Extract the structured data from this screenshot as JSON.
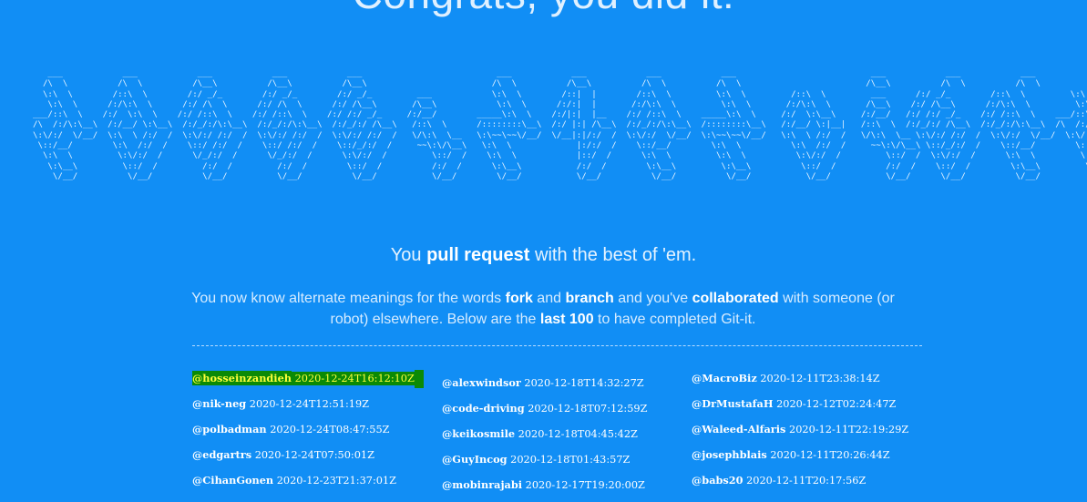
{
  "hero": {
    "title": "Congrats, you did it!"
  },
  "ascii_banner": "   ___            ___            ___            ___            ___                           ___            ___            ___            ___                           ___            ___            ___            ___\n  /\\  \\          /\\  \\          /\\__\\          /\\__\\          /\\__\\                         /\\  \\          /\\__\\          /\\  \\          /\\  \\                         /\\__\\          /\\  \\          /\\  \\\n  \\:\\  \\        /::\\  \\        /:/ _/_        /:/ _/_        /:/ _/_         ___            \\:\\  \\        /::|  |        /::\\  \\         \\:\\  \\         /::\\  \\         ___      /:/ _/_        /::\\  \\         \\:\\  \\\n   \\:\\  \\      /:/\\:\\  \\      /:/ /\\  \\      /:/ /\\  \\      /:/ /\\__\\       /\\__\\            \\:\\  \\      /:/:|  |       /:/\\:\\  \\         \\:\\  \\       /:/\\:\\  \\       /\\__\\    /:/ /\\__\\      /:/\\:\\  \\         \\:\\  \\\n___/::\\  \\    /:/  \\:\\  \\    /:/ /::\\  \\    /:/ /::\\  \\    /:/ /:/ _/_     /:/__/        _____\\:\\  \\    /:/|:|  |__    /:/ /::\\  \\    _____\\:\\  \\     /:/  \\:\\__\\     /:/__/   /:/ /:/ _/_    /:/ /::\\  \\    ___/::\\  \\\n/\\  /:/\\:\\__\\  /:/__/ \\:\\__\\  /:/_/:/\\:\\__\\  /:/_/:/\\:\\__\\  /:/_/:/ /\\__\\   /::\\  \\      /::::::::\\__\\  /:/ |:| /\\__\\  /:/_/:/\\:\\__\\  /::::::::\\__\\   /:/__/ \\:|__|   /::\\  \\  /:/_/:/ /\\__\\  /:/_/:/\\:\\__\\  /\\  /:/\\:\\__\\\n\\:\\/:/  \\/__/  \\:\\  \\ /:/  /  \\:\\/:/ /:/  /  \\:\\/:/ /:/  /  \\:\\/:/ /:/  /   \\/\\:\\  \\__   \\:\\~~\\~~\\/__/  \\/__|:|/:/  /  \\:\\/:/  \\/__/  \\:\\~~\\~~\\/__/   \\:\\  \\ /:/  /   \\/\\:\\  \\__ \\:\\/:/ /:/  /  \\:\\/:/  \\/__/  \\:\\/:/  \\/__/\n \\::/__/        \\:\\  /:/  /    \\::/ /:/  /    \\::/ /:/  /    \\::/_/:/  /     ~~\\:\\/\\__\\   \\:\\  \\             |:/:/  /    \\::/__/        \\:\\  \\          \\:\\  /:/  /     ~~\\:\\/\\__\\ \\::/_/:/  /    \\::/__/        \\::/__/\n  \\:\\  \\         \\:\\/:/  /      \\/_/:/  /      \\/_/:/  /      \\:\\/:/  /         \\::/  /    \\:\\  \\            |::/  /      \\:\\  \\         \\:\\  \\          \\:\\/:/  /         \\::/  /  \\:\\/:/  /      \\:\\  \\         \\:\\  \\\n   \\:\\__\\         \\::/  /         /:/  /         /:/  /        \\::/  /          /:/  /      \\:\\__\\           /:/  /        \\:\\__\\         \\:\\__\\          \\::/  /          /:/  /    \\::/  /        \\:\\__\\         \\:\\__\\\n    \\/__/          \\/__/          \\/__/          \\/__/          \\/__/           \\/__/        \\/__/           \\/__/          \\/__/          \\/__/           \\/__/           \\/__/      \\/__/          \\/__/          \\/__/",
  "tagline": {
    "prefix": "You ",
    "bold": "pull request",
    "suffix": " with the best of 'em."
  },
  "description": {
    "p1": "You now know alternate meanings for the words ",
    "b1": "fork",
    "p2": " and ",
    "b2": "branch",
    "p3": " and you've ",
    "b3": "collaborated",
    "p4": " with someone (or robot) elsewhere. Below are the ",
    "b4": "last 100",
    "p5": " to have completed Git-it."
  },
  "completions": {
    "column1": [
      {
        "handle": "@hosseinzandieh",
        "timestamp": "2020-12-24T16:12:10Z",
        "highlighted": true
      },
      {
        "handle": "@nik-neg",
        "timestamp": "2020-12-24T12:51:19Z"
      },
      {
        "handle": "@polbadman",
        "timestamp": "2020-12-24T08:47:55Z"
      },
      {
        "handle": "@edgartrs",
        "timestamp": "2020-12-24T07:50:01Z"
      },
      {
        "handle": "@CihanGonen",
        "timestamp": "2020-12-23T21:37:01Z"
      }
    ],
    "column2": [
      {
        "handle": "@alexwindsor",
        "timestamp": "2020-12-18T14:32:27Z"
      },
      {
        "handle": "@code-driving",
        "timestamp": "2020-12-18T07:12:59Z"
      },
      {
        "handle": "@keikosmile",
        "timestamp": "2020-12-18T04:45:42Z"
      },
      {
        "handle": "@GuyIncog",
        "timestamp": "2020-12-18T01:43:57Z"
      },
      {
        "handle": "@mobinrajabi",
        "timestamp": "2020-12-17T19:20:00Z"
      }
    ],
    "column3": [
      {
        "handle": "@MacroBiz",
        "timestamp": "2020-12-11T23:38:14Z"
      },
      {
        "handle": "@DrMustafaH",
        "timestamp": "2020-12-12T02:24:47Z"
      },
      {
        "handle": "@Waleed-Alfaris",
        "timestamp": "2020-12-11T22:19:29Z"
      },
      {
        "handle": "@josephblais",
        "timestamp": "2020-12-11T20:26:44Z"
      },
      {
        "handle": "@babs20",
        "timestamp": "2020-12-11T20:17:56Z"
      }
    ]
  },
  "colors": {
    "background": "#118ef5",
    "highlight_bg": "#0b8a06",
    "highlight_text": "#ffff3a"
  }
}
